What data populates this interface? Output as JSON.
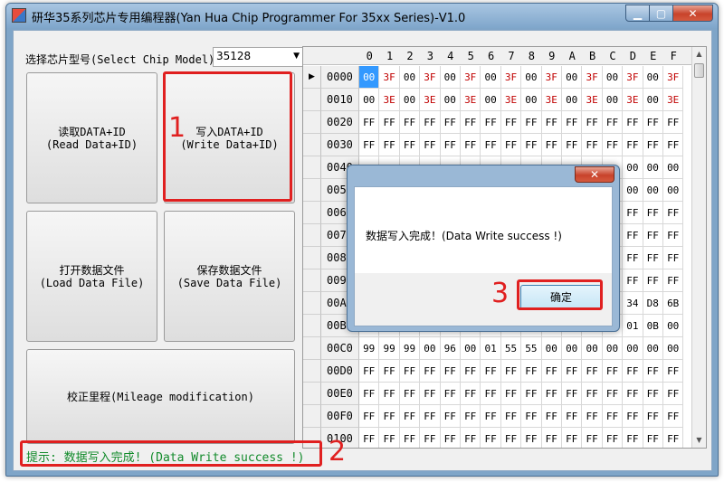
{
  "window": {
    "title": "研华35系列芯片专用编程器(Yan Hua Chip Programmer For 35xx Series)-V1.0",
    "min_label": "▁",
    "max_label": "▢",
    "close_label": "✕"
  },
  "chip": {
    "label": "选择芯片型号(Select Chip Model)",
    "value": "35128",
    "arrow": "▼"
  },
  "buttons": {
    "read_cn": "读取DATA+ID",
    "read_en": "(Read Data+ID)",
    "write_cn": "写入DATA+ID",
    "write_en": "(Write Data+ID)",
    "open_cn": "打开数据文件",
    "open_en": "(Load Data File)",
    "save_cn": "保存数据文件",
    "save_en": "(Save Data File)",
    "mileage": "校正里程(Mileage modification)"
  },
  "status": "提示: 数据写入完成! (Data Write success !)",
  "grid": {
    "columns": [
      "0",
      "1",
      "2",
      "3",
      "4",
      "5",
      "6",
      "7",
      "8",
      "9",
      "A",
      "B",
      "C",
      "D",
      "E",
      "F"
    ],
    "rows": [
      {
        "addr": "0000",
        "cells": [
          "00",
          "3F",
          "00",
          "3F",
          "00",
          "3F",
          "00",
          "3F",
          "00",
          "3F",
          "00",
          "3F",
          "00",
          "3F",
          "00",
          "3F"
        ]
      },
      {
        "addr": "0010",
        "cells": [
          "00",
          "3E",
          "00",
          "3E",
          "00",
          "3E",
          "00",
          "3E",
          "00",
          "3E",
          "00",
          "3E",
          "00",
          "3E",
          "00",
          "3E"
        ]
      },
      {
        "addr": "0020",
        "cells": [
          "FF",
          "FF",
          "FF",
          "FF",
          "FF",
          "FF",
          "FF",
          "FF",
          "FF",
          "FF",
          "FF",
          "FF",
          "FF",
          "FF",
          "FF",
          "FF"
        ]
      },
      {
        "addr": "0030",
        "cells": [
          "FF",
          "FF",
          "FF",
          "FF",
          "FF",
          "FF",
          "FF",
          "FF",
          "FF",
          "FF",
          "FF",
          "FF",
          "FF",
          "FF",
          "FF",
          "FF"
        ]
      },
      {
        "addr": "0040",
        "cells": [
          "",
          "",
          "",
          "",
          "",
          "",
          "",
          "",
          "",
          "",
          "",
          "",
          "",
          "00",
          "00",
          "00"
        ]
      },
      {
        "addr": "0050",
        "cells": [
          "",
          "",
          "",
          "",
          "",
          "",
          "",
          "",
          "",
          "",
          "",
          "",
          "",
          "00",
          "00",
          "00"
        ]
      },
      {
        "addr": "0060",
        "cells": [
          "",
          "",
          "",
          "",
          "",
          "",
          "",
          "",
          "",
          "",
          "",
          "",
          "",
          "FF",
          "FF",
          "FF"
        ]
      },
      {
        "addr": "0070",
        "cells": [
          "",
          "",
          "",
          "",
          "",
          "",
          "",
          "",
          "",
          "",
          "",
          "",
          "",
          "FF",
          "FF",
          "FF"
        ]
      },
      {
        "addr": "0080",
        "cells": [
          "",
          "",
          "",
          "",
          "",
          "",
          "",
          "",
          "",
          "",
          "",
          "",
          "",
          "FF",
          "FF",
          "FF"
        ]
      },
      {
        "addr": "0090",
        "cells": [
          "",
          "",
          "",
          "",
          "",
          "",
          "",
          "",
          "",
          "",
          "",
          "",
          "",
          "FF",
          "FF",
          "FF"
        ]
      },
      {
        "addr": "00A0",
        "cells": [
          "",
          "",
          "",
          "",
          "",
          "",
          "",
          "",
          "",
          "",
          "",
          "",
          "",
          "34",
          "D8",
          "6B"
        ]
      },
      {
        "addr": "00B0",
        "cells": [
          "",
          "",
          "",
          "",
          "",
          "",
          "",
          "",
          "",
          "",
          "",
          "",
          "",
          "01",
          "0B",
          "00"
        ]
      },
      {
        "addr": "00C0",
        "cells": [
          "99",
          "99",
          "99",
          "00",
          "96",
          "00",
          "01",
          "55",
          "55",
          "00",
          "00",
          "00",
          "00",
          "00",
          "00",
          "00"
        ]
      },
      {
        "addr": "00D0",
        "cells": [
          "FF",
          "FF",
          "FF",
          "FF",
          "FF",
          "FF",
          "FF",
          "FF",
          "FF",
          "FF",
          "FF",
          "FF",
          "FF",
          "FF",
          "FF",
          "FF"
        ]
      },
      {
        "addr": "00E0",
        "cells": [
          "FF",
          "FF",
          "FF",
          "FF",
          "FF",
          "FF",
          "FF",
          "FF",
          "FF",
          "FF",
          "FF",
          "FF",
          "FF",
          "FF",
          "FF",
          "FF"
        ]
      },
      {
        "addr": "00F0",
        "cells": [
          "FF",
          "FF",
          "FF",
          "FF",
          "FF",
          "FF",
          "FF",
          "FF",
          "FF",
          "FF",
          "FF",
          "FF",
          "FF",
          "FF",
          "FF",
          "FF"
        ]
      },
      {
        "addr": "0100",
        "cells": [
          "FF",
          "FF",
          "FF",
          "FF",
          "FF",
          "FF",
          "FF",
          "FF",
          "FF",
          "FF",
          "FF",
          "FF",
          "FF",
          "FF",
          "FF",
          "FF"
        ]
      }
    ],
    "selected_marker": "▶",
    "scroll_up": "▲",
    "scroll_down": "▼"
  },
  "dialog": {
    "close_label": "✕",
    "message": "数据写入完成！(Data Write success !)",
    "ok_label": "确定"
  },
  "annotations": [
    "1",
    "2",
    "3"
  ],
  "colors": {
    "accent_red": "#e02020",
    "status_green": "#118a2a",
    "hex_red": "#c00000",
    "selection_blue": "#3399ff"
  }
}
